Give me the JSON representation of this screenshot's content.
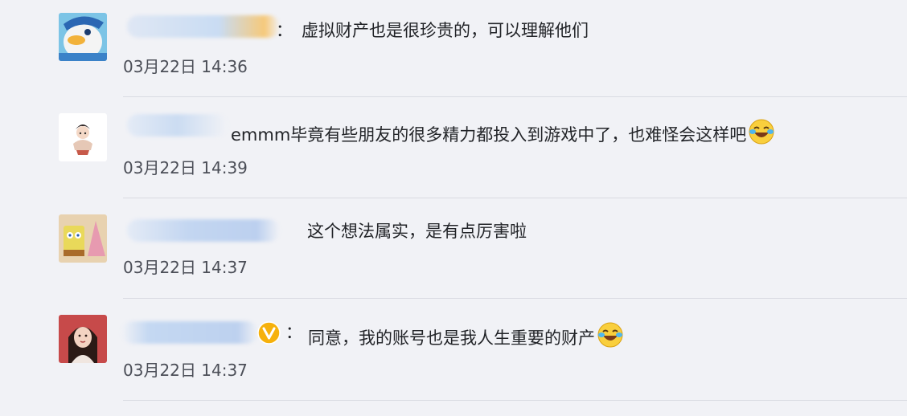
{
  "comments": [
    {
      "colon": "：",
      "text": "虚拟财产也是很珍贵的，可以理解他们",
      "time": "03月22日 14:36",
      "avatar": "donald-duck-avatar-icon"
    },
    {
      "text": "emmm毕竟有些朋友的很多精力都投入到游戏中了，也难怪会这样吧",
      "time": "03月22日 14:39",
      "avatar": "cartoon-figure-avatar-icon",
      "emoji": "laugh-cry-emoji-icon"
    },
    {
      "text": "这个想法属实，是有点厉害啦",
      "time": "03月22日 14:37",
      "avatar": "spongebob-avatar-icon"
    },
    {
      "colon": "：",
      "text": "同意，我的账号也是我人生重要的财产",
      "time": "03月22日 14:37",
      "avatar": "girl-photo-avatar-icon",
      "badge": "verified-v-badge-icon",
      "emoji": "laugh-cry-emoji-icon"
    }
  ],
  "colors": {
    "background": "#f1f2f6",
    "divider": "#d9dbe2",
    "text": "#222428",
    "timestamp": "#4b4e57",
    "blur_name": "#bcd3f0",
    "badge": "#f6b10c"
  }
}
